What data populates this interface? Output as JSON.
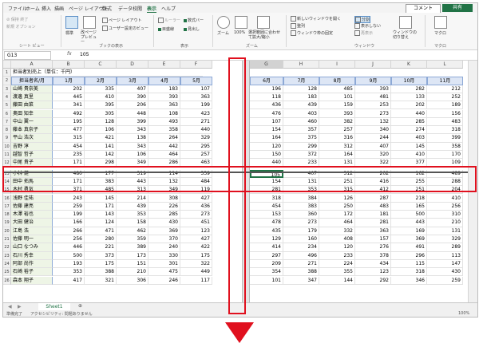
{
  "menu": {
    "tabs": [
      "ファイル",
      "ホーム",
      "挿入",
      "描画",
      "ページ レイアウト",
      "数式",
      "データ",
      "校閲",
      "表示",
      "ヘルプ"
    ],
    "active": "表示",
    "comment": "コメント",
    "share": "共有"
  },
  "ribbon": {
    "sheetview_top": "⊘ 保持  終了",
    "sheetview_new": "新規  オプション",
    "sheetview_group": "シート ビュー",
    "standard": "標準",
    "page_break": "改ページ プレビュー",
    "page_layout": "ページ レイアウト",
    "custom_view": "ユーザー設定のビュー",
    "book_view_group": "ブックの表示",
    "ruler": "ルーラー",
    "formula_bar": "数式バー",
    "gridlines": "目盛線",
    "headings": "見出し",
    "show_group": "表示",
    "zoom": "ズーム",
    "zoom100": "100%",
    "zoom_selection": "選択範囲に合わせて拡大/縮小",
    "zoom_group": "ズーム",
    "new_window": "新しいウィンドウを開く",
    "arrange": "整列",
    "freeze": "ウィンドウ枠の固定",
    "split": "分割",
    "hide": "表示しない",
    "unhide": "再表示",
    "switch_window": "ウィンドウの切り替え",
    "window_group": "ウィンドウ",
    "macro": "マクロ",
    "macro_group": "マクロ"
  },
  "formula": {
    "cell": "G13",
    "fx": "fx",
    "value": "105"
  },
  "columns_left": [
    "A",
    "B",
    "C",
    "D",
    "E",
    "F"
  ],
  "columns_right": [
    "G",
    "H",
    "I",
    "J",
    "K",
    "L"
  ],
  "title_cell": "担当者別売上（単位：千円）",
  "header_row": [
    "担当者名/月",
    "1月",
    "2月",
    "3月",
    "4月",
    "5月",
    "6月",
    "7月",
    "8月",
    "9月",
    "10月",
    "11月"
  ],
  "rows": [
    {
      "n": "3",
      "name": "山崎 貴奈美",
      "v": [
        "202",
        "335",
        "407",
        "183",
        "107",
        "196",
        "128",
        "485",
        "393",
        "282",
        "212"
      ]
    },
    {
      "n": "4",
      "name": "渡邊 真里",
      "v": [
        "445",
        "410",
        "390",
        "393",
        "363",
        "118",
        "183",
        "101",
        "481",
        "133",
        "252"
      ]
    },
    {
      "n": "5",
      "name": "藤田 由菜",
      "v": [
        "341",
        "395",
        "206",
        "363",
        "199",
        "436",
        "439",
        "159",
        "253",
        "202",
        "189"
      ]
    },
    {
      "n": "6",
      "name": "奥田 知幸",
      "v": [
        "492",
        "305",
        "448",
        "108",
        "423",
        "476",
        "403",
        "393",
        "273",
        "440",
        "156"
      ]
    },
    {
      "n": "7",
      "name": "中山 翼一",
      "v": [
        "195",
        "128",
        "399",
        "493",
        "271",
        "107",
        "460",
        "382",
        "132",
        "285",
        "483"
      ]
    },
    {
      "n": "8",
      "name": "藤本 真奈子",
      "v": [
        "477",
        "106",
        "343",
        "358",
        "440",
        "154",
        "357",
        "257",
        "340",
        "274",
        "318"
      ]
    },
    {
      "n": "9",
      "name": "平山 浩次",
      "v": [
        "315",
        "421",
        "138",
        "264",
        "329",
        "164",
        "375",
        "316",
        "244",
        "403",
        "399"
      ]
    },
    {
      "n": "10",
      "name": "吉野 淳",
      "v": [
        "454",
        "141",
        "343",
        "442",
        "295",
        "120",
        "299",
        "312",
        "407",
        "145",
        "358"
      ]
    },
    {
      "n": "11",
      "name": "越智 哲子",
      "v": [
        "235",
        "142",
        "106",
        "464",
        "257",
        "150",
        "372",
        "164",
        "320",
        "410",
        "170"
      ]
    },
    {
      "n": "12",
      "name": "中尾 貴子",
      "v": [
        "171",
        "298",
        "349",
        "286",
        "463",
        "440",
        "233",
        "131",
        "322",
        "377",
        "109"
      ]
    },
    {
      "n": "13",
      "name": "小林 健一",
      "v": [
        "480",
        "177",
        "319",
        "114",
        "339",
        "105",
        "407",
        "312",
        "202",
        "162",
        "489"
      ]
    },
    {
      "n": "14",
      "name": "田中 拓馬",
      "v": [
        "171",
        "383",
        "443",
        "132",
        "484",
        "154",
        "131",
        "251",
        "416",
        "255",
        "288"
      ]
    },
    {
      "n": "15",
      "name": "木村 勇気",
      "v": [
        "371",
        "485",
        "313",
        "349",
        "119",
        "281",
        "353",
        "315",
        "412",
        "251",
        "204"
      ]
    },
    {
      "n": "16",
      "name": "浅野 佳祐",
      "v": [
        "243",
        "145",
        "214",
        "308",
        "427",
        "318",
        "384",
        "126",
        "287",
        "218",
        "410"
      ]
    },
    {
      "n": "17",
      "name": "佐藤 建亮",
      "v": [
        "259",
        "171",
        "439",
        "226",
        "436",
        "454",
        "383",
        "250",
        "483",
        "165",
        "256"
      ]
    },
    {
      "n": "18",
      "name": "木澤 裕也",
      "v": [
        "199",
        "143",
        "353",
        "285",
        "273",
        "153",
        "360",
        "172",
        "181",
        "500",
        "310"
      ]
    },
    {
      "n": "19",
      "name": "大田 健治",
      "v": [
        "166",
        "124",
        "158",
        "430",
        "451",
        "478",
        "273",
        "464",
        "281",
        "443",
        "210"
      ]
    },
    {
      "n": "20",
      "name": "江島 浩",
      "v": [
        "266",
        "471",
        "462",
        "369",
        "123",
        "435",
        "179",
        "332",
        "363",
        "169",
        "131"
      ]
    },
    {
      "n": "21",
      "name": "佐藤 明一",
      "v": [
        "256",
        "280",
        "359",
        "370",
        "427",
        "129",
        "160",
        "408",
        "157",
        "369",
        "329"
      ]
    },
    {
      "n": "22",
      "name": "山口 なつみ",
      "v": [
        "446",
        "221",
        "389",
        "240",
        "422",
        "414",
        "234",
        "120",
        "276",
        "491",
        "289"
      ]
    },
    {
      "n": "23",
      "name": "石川 秀幸",
      "v": [
        "500",
        "373",
        "173",
        "330",
        "175",
        "297",
        "496",
        "233",
        "378",
        "296",
        "113"
      ]
    },
    {
      "n": "24",
      "name": "阿部 尚作",
      "v": [
        "193",
        "175",
        "151",
        "301",
        "322",
        "209",
        "271",
        "224",
        "434",
        "115",
        "147"
      ]
    },
    {
      "n": "25",
      "name": "石崎 裕子",
      "v": [
        "353",
        "388",
        "210",
        "475",
        "449",
        "354",
        "388",
        "355",
        "123",
        "318",
        "430"
      ]
    },
    {
      "n": "26",
      "name": "森本 翔子",
      "v": [
        "417",
        "321",
        "306",
        "246",
        "117",
        "101",
        "347",
        "144",
        "292",
        "346",
        "259"
      ]
    }
  ],
  "sheet_tab": "Sheet1",
  "status": {
    "ready": "準備完了",
    "accessibility": "アクセシビリティ: 問題ありません",
    "zoom": "100%"
  }
}
